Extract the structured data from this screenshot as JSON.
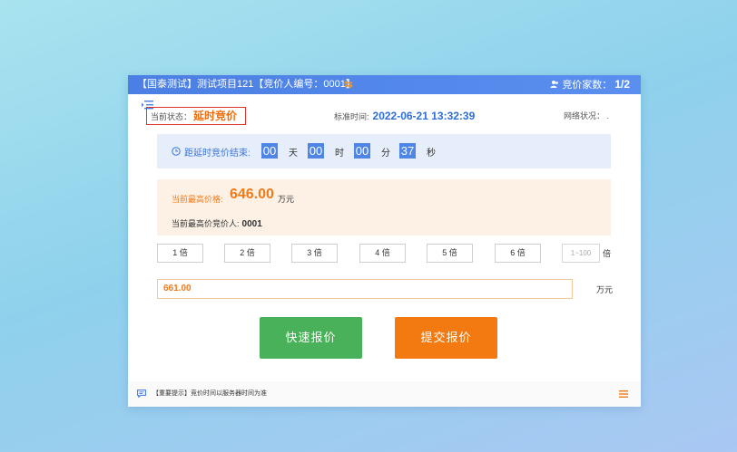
{
  "header": {
    "title": "【国泰测试】测试项目121【竞价人编号：0001】",
    "bidder_count_label": "竞价家数：",
    "bidder_count": "1/2"
  },
  "status": {
    "current_label": "当前状态：",
    "current_value": "延时竞价",
    "std_time_label": "标准时间:",
    "std_time_value": "2022-06-21 13:32:39",
    "network_label": "网络状况：",
    "network_value": "."
  },
  "countdown": {
    "label": "距延时竞价结束:",
    "days": "00",
    "days_unit": "天",
    "hours": "00",
    "hours_unit": "时",
    "minutes": "00",
    "minutes_unit": "分",
    "seconds": "37",
    "seconds_unit": "秒"
  },
  "highest": {
    "price_label": "当前最高价格:",
    "price_value": "646.00",
    "price_unit": "万元",
    "bidder_label": "当前最高价竞价人:",
    "bidder_value": "0001"
  },
  "multipliers": [
    "1 倍",
    "2 倍",
    "3 倍",
    "4 倍",
    "5 倍",
    "6 倍"
  ],
  "custom_multiplier": {
    "placeholder": "1~100",
    "unit": "倍"
  },
  "bid": {
    "value": "661.00",
    "unit": "万元"
  },
  "buttons": {
    "quick": "快速报价",
    "submit": "提交报价"
  },
  "footer": {
    "tip": "【重要提示】竞价时间以服务器时间为准"
  },
  "colors": {
    "header_blue": "#4b7fe3",
    "orange": "#ef7a1a",
    "green": "#49b15a",
    "countdown_blue": "#4f86e6"
  }
}
